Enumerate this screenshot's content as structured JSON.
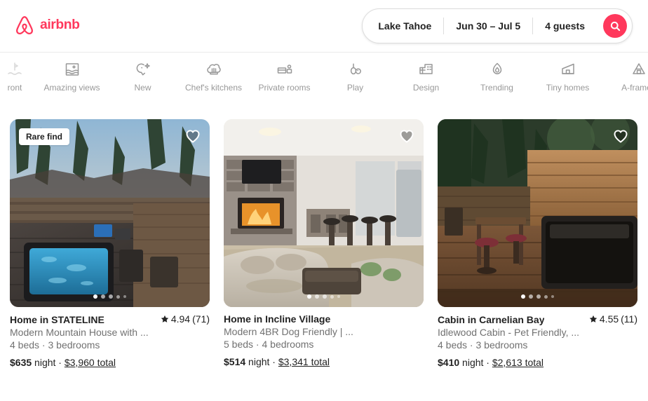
{
  "header": {
    "brand_name": "airbnb",
    "brand_color": "#FF385C",
    "search": {
      "location": "Lake Tahoe",
      "dates": "Jun 30 – Jul 5",
      "guests": "4 guests",
      "search_icon": "search-icon"
    }
  },
  "category_nav": {
    "prev_icon": "chevron-left-icon",
    "items": [
      {
        "label": "ront",
        "icon": "lakefront-icon",
        "partial": true
      },
      {
        "label": "Amazing views",
        "icon": "amazing-views-icon"
      },
      {
        "label": "New",
        "icon": "new-sparkle-icon"
      },
      {
        "label": "Chef's kitchens",
        "icon": "chef-hat-icon"
      },
      {
        "label": "Private rooms",
        "icon": "private-room-icon"
      },
      {
        "label": "Play",
        "icon": "play-icon"
      },
      {
        "label": "Design",
        "icon": "design-building-icon"
      },
      {
        "label": "Trending",
        "icon": "flame-icon"
      },
      {
        "label": "Tiny homes",
        "icon": "tiny-home-icon"
      },
      {
        "label": "A-frames",
        "icon": "a-frame-icon"
      }
    ]
  },
  "listings": [
    {
      "badge": "Rare find",
      "title": "Home in STATELINE",
      "subtitle": "Modern Mountain House with ...",
      "beds": "4 beds · 3 bedrooms",
      "price_amount": "$635",
      "price_unit": "night",
      "price_total": "$3,960 total",
      "rating": "4.94",
      "reviews": "(71)",
      "photo_alt": "hot-tub-deck-photo",
      "dots": 5,
      "active_dot": 0,
      "favorite_icon": "heart-icon"
    },
    {
      "badge": null,
      "title": "Home in Incline Village",
      "subtitle": "Modern 4BR Dog Friendly | ...",
      "beds": "5 beds · 4 bedrooms",
      "price_amount": "$514",
      "price_unit": "night",
      "price_total": "$3,341 total",
      "rating": null,
      "reviews": null,
      "photo_alt": "living-room-fireplace-photo",
      "dots": 5,
      "active_dot": 0,
      "favorite_icon": "heart-icon"
    },
    {
      "badge": null,
      "title": "Cabin in Carnelian Bay",
      "subtitle": "Idlewood Cabin - Pet Friendly, ...",
      "beds": "4 beds · 3 bedrooms",
      "price_amount": "$410",
      "price_unit": "night",
      "price_total": "$2,613 total",
      "rating": "4.55",
      "reviews": "(11)",
      "photo_alt": "outdoor-patio-hot-tub-photo",
      "dots": 5,
      "active_dot": 0,
      "favorite_icon": "heart-icon"
    }
  ],
  "separator": "·"
}
